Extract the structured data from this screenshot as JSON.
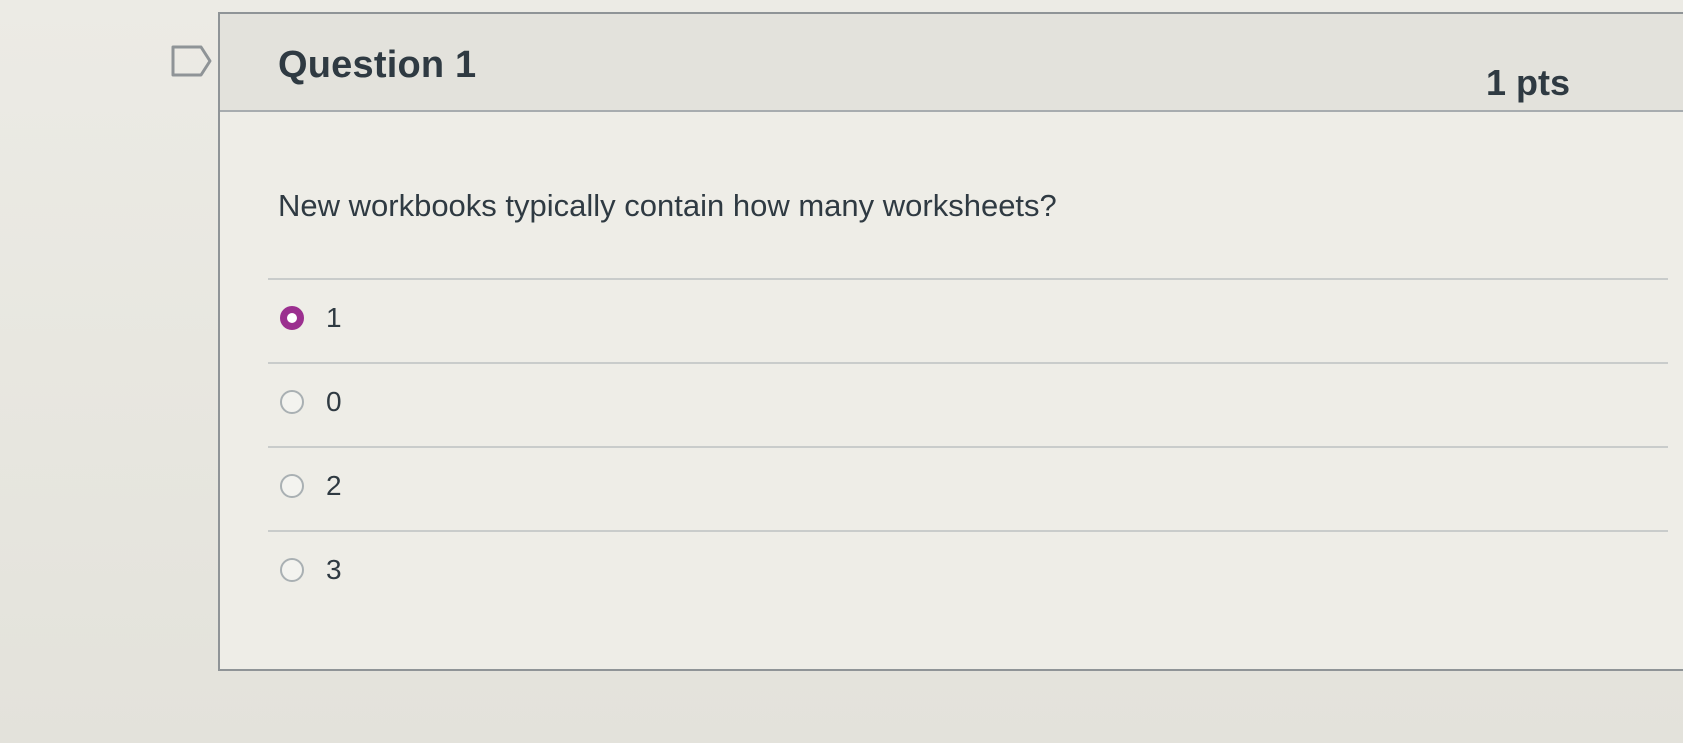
{
  "question": {
    "title": "Question 1",
    "points": "1 pts",
    "text": "New workbooks typically contain how many worksheets?",
    "flag_icon": "flag-outline-icon"
  },
  "answers": [
    {
      "label": "1",
      "selected": true
    },
    {
      "label": "0",
      "selected": false
    },
    {
      "label": "2",
      "selected": false
    },
    {
      "label": "3",
      "selected": false
    }
  ],
  "colors": {
    "selected_radio": "#9b2f8f",
    "text": "#2f3a42",
    "header_bg": "#e3e2dc"
  }
}
